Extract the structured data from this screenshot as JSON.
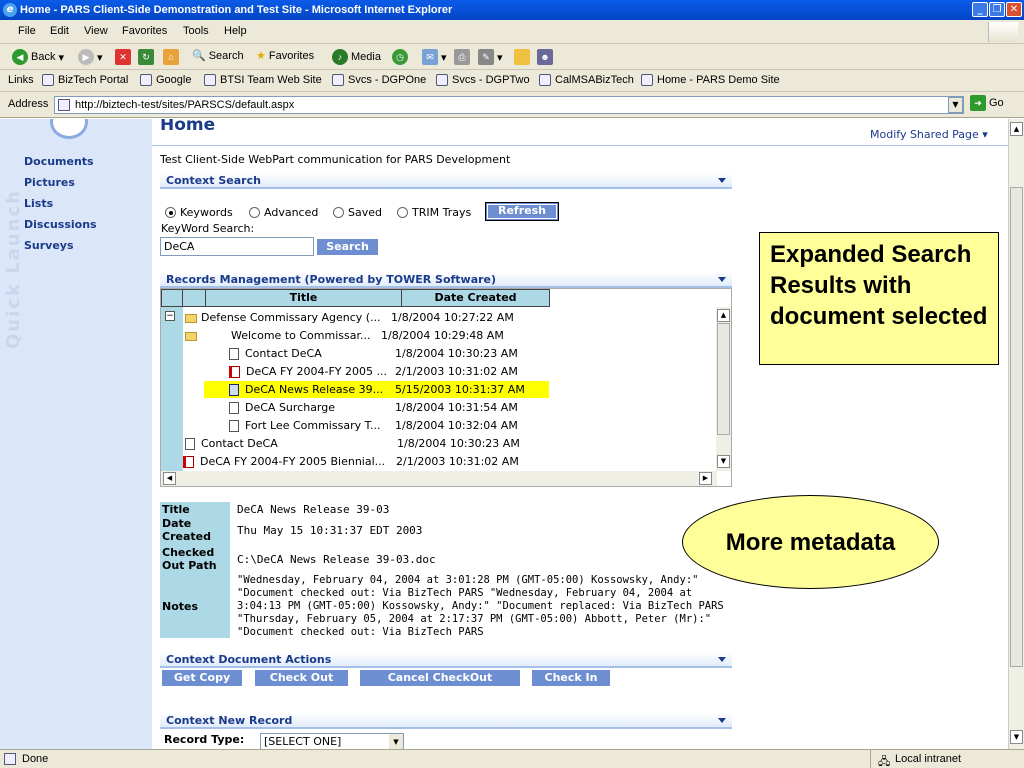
{
  "window": {
    "title": "Home - PARS Client-Side Demonstration and Test Site - Microsoft Internet Explorer"
  },
  "menu": [
    "File",
    "Edit",
    "View",
    "Favorites",
    "Tools",
    "Help"
  ],
  "toolbar": {
    "back": "Back",
    "search": "Search",
    "favorites": "Favorites",
    "media": "Media"
  },
  "links": {
    "label": "Links",
    "items": [
      "BizTech Portal",
      "Google",
      "BTSI Team Web Site",
      "Svcs - DGPOne",
      "Svcs - DGPTwo",
      "CalMSABizTech",
      "Home - PARS Demo Site"
    ]
  },
  "address": {
    "label": "Address",
    "url": "http://biztech-test/sites/PARSCS/default.aspx",
    "go": "Go"
  },
  "page": {
    "title": "Home",
    "modify": "Modify Shared Page",
    "description": "Test Client-Side WebPart communication for PARS Development",
    "quick_launch": "Quick Launch",
    "nav": [
      "Documents",
      "Pictures",
      "Lists",
      "Discussions",
      "Surveys"
    ]
  },
  "context_search": {
    "header": "Context Search",
    "options": [
      "Keywords",
      "Advanced",
      "Saved",
      "TRIM Trays"
    ],
    "selected": "Keywords",
    "refresh": "Refresh",
    "keyword_label": "KeyWord Search:",
    "keyword_value": "DeCA",
    "search_button": "Search"
  },
  "records": {
    "header": "Records Management (Powered by TOWER Software)",
    "columns": [
      "Title",
      "Date Created"
    ],
    "rows": [
      {
        "title": "Defense Commissary Agency (...",
        "date": "1/8/2004 10:27:22 AM"
      },
      {
        "title": "Welcome to Commissar...",
        "date": "1/8/2004 10:29:48 AM"
      },
      {
        "title": "Contact DeCA",
        "date": "1/8/2004 10:30:23 AM"
      },
      {
        "title": "DeCA FY 2004-FY 2005 ...",
        "date": "2/1/2003 10:31:02 AM"
      },
      {
        "title": "DeCA News Release 39...",
        "date": "5/15/2003 10:31:37 AM"
      },
      {
        "title": "DeCA Surcharge",
        "date": "1/8/2004 10:31:54 AM"
      },
      {
        "title": "Fort Lee Commissary T...",
        "date": "1/8/2004 10:32:04 AM"
      },
      {
        "title": "Contact DeCA",
        "date": "1/8/2004 10:30:23 AM"
      },
      {
        "title": "DeCA FY 2004-FY 2005 Biennial...",
        "date": "2/1/2003 10:31:02 AM"
      }
    ]
  },
  "metadata": {
    "title_label": "Title",
    "title": "DeCA News Release 39-03",
    "date_label": "Date Created",
    "date": "Thu May 15 10:31:37 EDT 2003",
    "checked_label": "Checked Out Path",
    "checked": "C:\\DeCA News Release 39-03.doc",
    "notes_label": "Notes",
    "notes": [
      "\"Wednesday, February 04, 2004 at 3:01:28 PM (GMT-05:00) Kossowsky, Andy:\"",
      "\"Document checked out: Via BizTech PARS \"Wednesday, February 04, 2004 at",
      "3:04:13 PM (GMT-05:00) Kossowsky, Andy:\" \"Document replaced: Via BizTech PARS",
      "\"Thursday, February 05, 2004 at 2:17:37 PM (GMT-05:00) Abbott, Peter (Mr):\"",
      "\"Document checked out: Via BizTech PARS"
    ]
  },
  "actions": {
    "header": "Context Document Actions",
    "buttons": [
      "Get Copy",
      "Check Out",
      "Cancel CheckOut",
      "Check In"
    ]
  },
  "new_record": {
    "header": "Context New Record",
    "record_type_label": "Record Type:",
    "record_type_value": "[SELECT ONE]"
  },
  "callouts": {
    "expanded": "Expanded Search Results with document selected",
    "more": "More metadata"
  },
  "status": {
    "left": "Done",
    "zone": "Local intranet"
  },
  "colors": {
    "highlight": "#ffff00",
    "callout": "#ffff99",
    "header_blue": "#add8e6",
    "nav_bg": "#dbe7f9"
  }
}
